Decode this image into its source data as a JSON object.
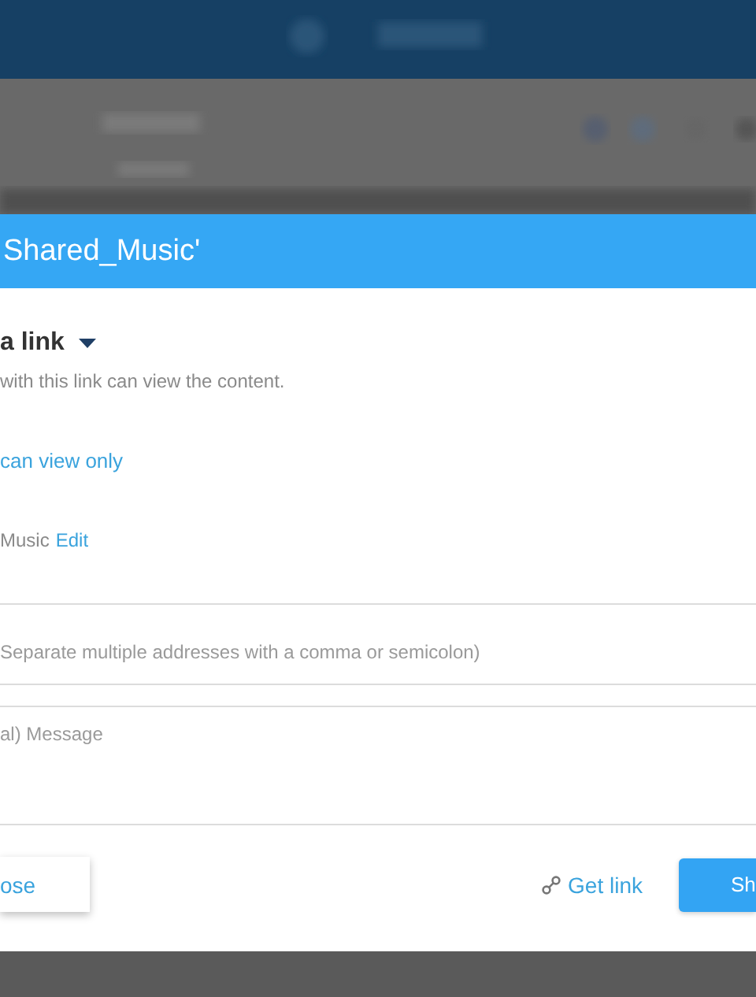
{
  "dialog": {
    "title": "Shared_Music'",
    "link_type": {
      "label": "a link"
    },
    "description": "with this link can view the content.",
    "permission": "can view only",
    "folder": {
      "name": "Music",
      "edit": "Edit"
    },
    "recipients": {
      "placeholder": "Separate multiple addresses with a comma or semicolon)"
    },
    "message": {
      "placeholder": "al) Message"
    },
    "buttons": {
      "close": "ose",
      "get_link": "Get link",
      "share": "Sh"
    }
  }
}
